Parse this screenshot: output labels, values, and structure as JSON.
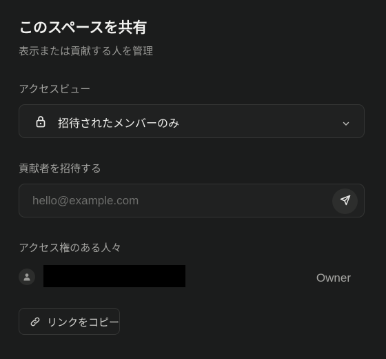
{
  "dialog": {
    "title": "このスペースを共有",
    "subtitle": "表示または貢献する人を管理"
  },
  "access": {
    "label": "アクセスビュー",
    "selected_value": "招待されたメンバーのみ",
    "icon": "lock-icon"
  },
  "invite": {
    "label": "貢献者を招待する",
    "placeholder": "hello@example.com",
    "send_icon": "send-icon"
  },
  "people": {
    "label": "アクセス権のある人々",
    "members": [
      {
        "name": "",
        "role": "Owner"
      }
    ]
  },
  "actions": {
    "copy_link_label": "リンクをコピー"
  },
  "colors": {
    "background": "#1b1c1c",
    "field_background": "#202121",
    "border": "#343534"
  }
}
